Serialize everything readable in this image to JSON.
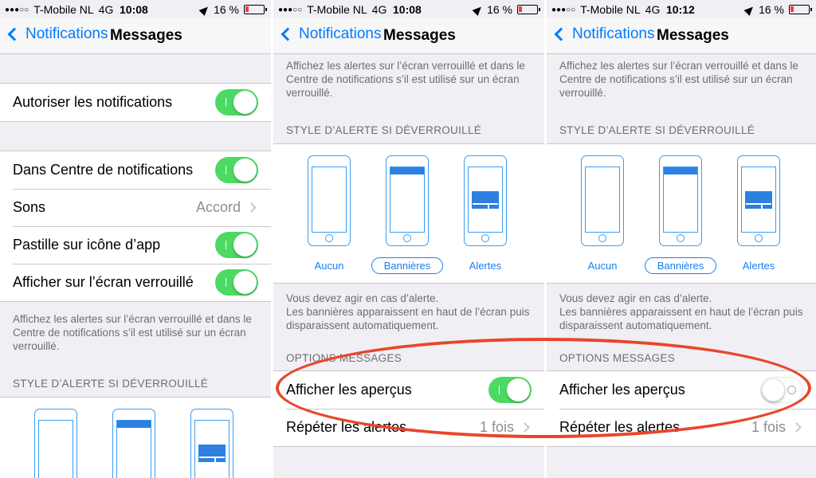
{
  "status": {
    "carrier": "T-Mobile NL",
    "network": "4G",
    "battery": "16 %",
    "times": [
      "10:08",
      "10:08",
      "10:12"
    ]
  },
  "nav": {
    "back_label": "Notifications",
    "title": "Messages"
  },
  "panel1": {
    "allow_label": "Autoriser les notifications",
    "rows": {
      "center": "Dans Centre de notifications",
      "sounds": "Sons",
      "sounds_value": "Accord",
      "badge": "Pastille sur icône d’app",
      "lock": "Afficher sur l’écran verrouillé"
    }
  },
  "lock_footer": "Affichez les alertes sur l’écran verrouillé et dans le Centre de notifications s’il est utilisé sur un écran verrouillé.",
  "alert_style_header": "STYLE D’ALERTE SI DÉVERROUILLÉ",
  "alert_styles": {
    "none": "Aucun",
    "banners": "Bannières",
    "alerts": "Alertes"
  },
  "banner_footer": "Vous devez agir en cas d’alerte.\nLes bannières apparaissent en haut de l’écran puis disparaissent automatiquement.",
  "options_header": "OPTIONS MESSAGES",
  "options": {
    "previews": "Afficher les aperçus",
    "repeat": "Répéter les alertes",
    "repeat_value": "1 fois"
  },
  "colors": {
    "accent": "#007aff",
    "switch_on": "#4cd964",
    "highlight": "#e8462a"
  },
  "states": {
    "panel2_previews": "on",
    "panel3_previews": "off"
  }
}
